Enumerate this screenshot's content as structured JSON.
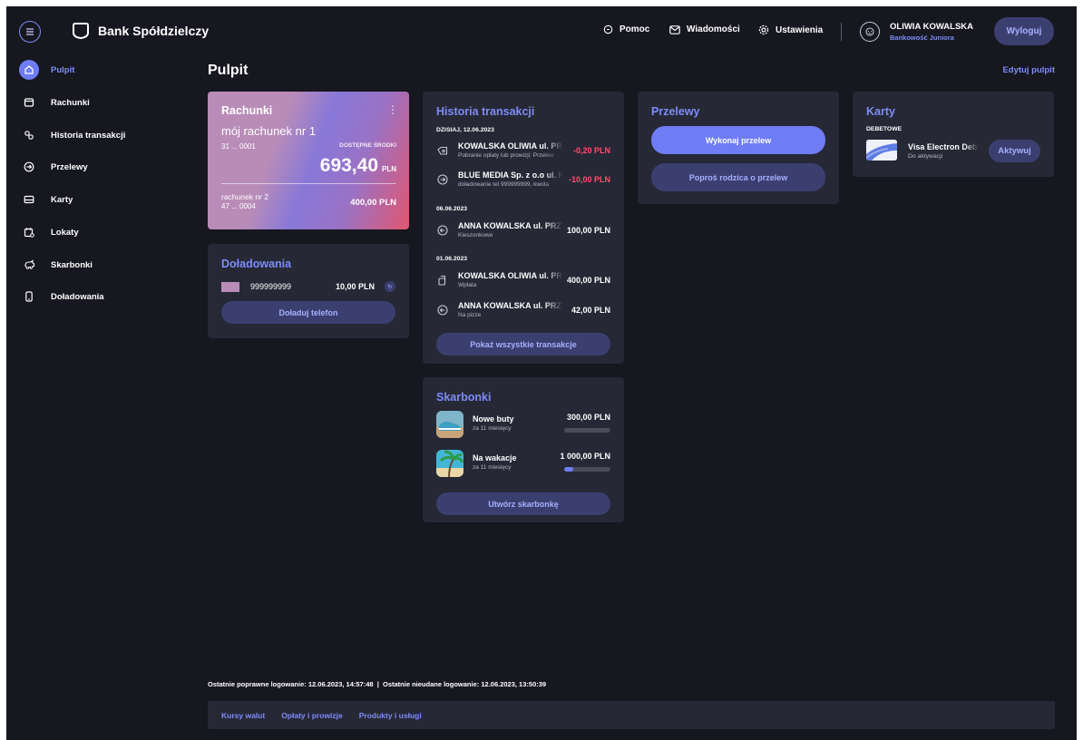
{
  "app": {
    "name": "Bank Spółdzielczy"
  },
  "header": {
    "help": "Pomoc",
    "messages": "Wiadomości",
    "settings": "Ustawienia",
    "user_name": "OLIWIA KOWALSKA",
    "user_subtitle": "Bankowość Juniora",
    "logout": "Wyloguj"
  },
  "sidebar": {
    "items": [
      {
        "label": "Pulpit",
        "icon": "home-icon",
        "active": true
      },
      {
        "label": "Rachunki",
        "icon": "wallet-icon"
      },
      {
        "label": "Historia transakcji",
        "icon": "history-icon"
      },
      {
        "label": "Przelewy",
        "icon": "transfer-icon"
      },
      {
        "label": "Karty",
        "icon": "card-icon"
      },
      {
        "label": "Lokaty",
        "icon": "calendar-icon"
      },
      {
        "label": "Skarbonki",
        "icon": "piggy-bank-icon"
      },
      {
        "label": "Doładowania",
        "icon": "phone-icon"
      }
    ]
  },
  "main": {
    "title": "Pulpit",
    "edit_link": "Edytuj pulpit"
  },
  "accounts": {
    "title": "Rachunki",
    "primary": {
      "name": "mój rachunek nr 1",
      "number": "31 ... 0001",
      "available_label": "DOSTĘPNE ŚRODKI",
      "balance": "693,40",
      "currency": "PLN"
    },
    "secondary": {
      "name": "rachunek nr 2",
      "number": "47 ... 0004",
      "balance": "400,00 PLN"
    }
  },
  "topups": {
    "title": "Doładowania",
    "phone": "999999999",
    "amount": "10,00 PLN",
    "button": "Doładuj telefon"
  },
  "history": {
    "title": "Historia transakcji",
    "groups": [
      {
        "date": "DZISIAJ, 12.06.2023",
        "items": [
          {
            "name": "KOWALSKA OLIWIA ul. PRZYKŁADOWA",
            "sub": "Pobranie opłaty lub prowizji: Przelew",
            "amount": "-0,20 PLN",
            "negative": true,
            "icon": "fee-icon"
          },
          {
            "name": "BLUE MEDIA Sp. z o.o ul. Haffnera",
            "sub": "doładowanie tel 999999999, kwota",
            "amount": "-10,00 PLN",
            "negative": true,
            "icon": "outgoing-icon"
          }
        ]
      },
      {
        "date": "06.06.2023",
        "items": [
          {
            "name": "ANNA KOWALSKA ul. PRZYKŁADOWA",
            "sub": "Kieszonkowe",
            "amount": "100,00 PLN",
            "negative": false,
            "icon": "incoming-icon"
          }
        ]
      },
      {
        "date": "01.06.2023",
        "items": [
          {
            "name": "KOWALSKA OLIWIA ul. PRZYKŁADOWA",
            "sub": "Wpłata",
            "amount": "400,00 PLN",
            "negative": false,
            "icon": "deposit-icon"
          },
          {
            "name": "ANNA KOWALSKA ul. PRZYKŁADOWA",
            "sub": "Na pizze",
            "amount": "42,00 PLN",
            "negative": false,
            "icon": "incoming-icon"
          }
        ]
      }
    ],
    "show_all": "Pokaż wszystkie transakcje"
  },
  "transfers": {
    "title": "Przelewy",
    "make": "Wykonaj przelew",
    "ask_parent": "Poproś rodzica o przelew"
  },
  "cards": {
    "title": "Karty",
    "section": "DEBETOWE",
    "name": "Visa Electron Debit",
    "status": "Do aktywacji",
    "activate": "Aktywuj"
  },
  "piggy": {
    "title": "Skarbonki",
    "items": [
      {
        "name": "Nowe buty",
        "sub": "za 11 miesięcy",
        "amount": "300,00 PLN",
        "progress": 0.0
      },
      {
        "name": "Na wakacje",
        "sub": "za 11 miesięcy",
        "amount": "1 000,00 PLN",
        "progress": 0.2
      }
    ],
    "create": "Utwórz skarbonkę"
  },
  "footer": {
    "login_info": "Ostatnie poprawne logowanie: 12.06.2023, 14:57:48  |  Ostatnie nieudane logowanie: 12.06.2023, 13:50:39",
    "links": [
      "Kursy walut",
      "Opłaty i prowizje",
      "Produkty i usługi"
    ]
  }
}
